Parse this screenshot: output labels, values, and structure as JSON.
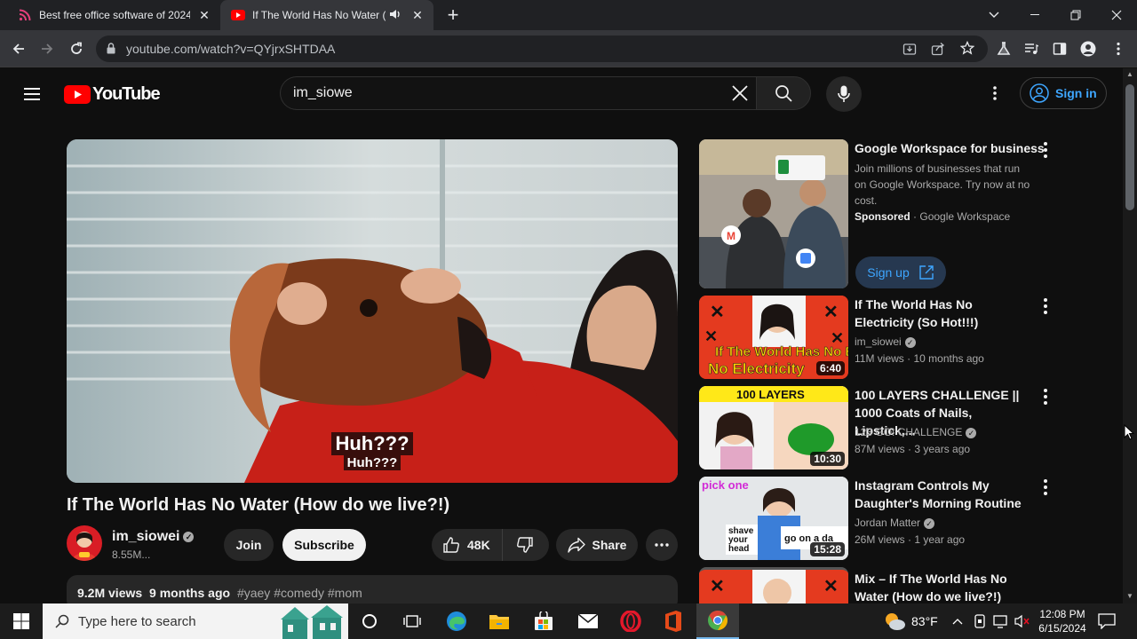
{
  "browser": {
    "tabs": [
      {
        "title": "Best free office software of 2024",
        "icon": "rss-icon"
      },
      {
        "title": "If The World Has No Water (How do we live?!) - YouTube",
        "icon": "youtube-icon",
        "audio": true
      }
    ],
    "url": "youtube.com/watch?v=QYjrxSHTDAA"
  },
  "youtube": {
    "logo_text": "YouTube",
    "search_value": "im_siowe",
    "signin_label": "Sign in"
  },
  "video": {
    "subtitle_big": "Huh???",
    "subtitle_small": "Huh???",
    "title": "If The World Has No Water (How do we live?!)",
    "channel": "im_siowei",
    "subscribers": "8.55M...",
    "join_label": "Join",
    "subscribe_label": "Subscribe",
    "likes": "48K",
    "share_label": "Share",
    "views": "9.2M views",
    "age": "9 months ago",
    "tags": "#yaey #comedy #mom"
  },
  "sidebar": {
    "ad": {
      "title": "Google Workspace for business",
      "description": "Join millions of businesses that run on Google Workspace. Try now at no cost.",
      "sponsored": "Sponsored",
      "advertiser": "Google Workspace",
      "cta": "Sign up"
    },
    "videos": [
      {
        "title": "If The World Has No Electricity (So Hot!!!)",
        "channel": "im_siowei",
        "views": "11M views",
        "age": "10 months ago",
        "duration": "6:40",
        "thumb_text": "If The World Has No Electricity"
      },
      {
        "title": "100 LAYERS CHALLENGE || 1000 Coats of Nails, Lipstick,...",
        "channel": "123 GO! CHALLENGE",
        "views": "87M views",
        "age": "3 years ago",
        "duration": "10:30",
        "thumb_text": "100 LAYERS"
      },
      {
        "title": "Instagram Controls My Daughter's Morning Routine",
        "channel": "Jordan Matter",
        "views": "26M views",
        "age": "1 year ago",
        "duration": "15:28",
        "thumb_text": "pick one",
        "thumb_opt1": "shave your head",
        "thumb_opt2": "go on a da"
      },
      {
        "title": "Mix – If The World Has No Water (How do we live?!)"
      }
    ]
  },
  "taskbar": {
    "search_placeholder": "Type here to search",
    "temperature": "83°F",
    "time": "12:08 PM",
    "date": "6/15/2024"
  }
}
